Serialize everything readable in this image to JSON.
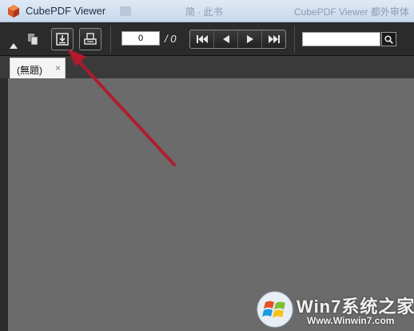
{
  "window": {
    "title": "CubePDF Viewer",
    "background_titles": [
      "简 · 此书",
      "CubePDF Viewer 都外审体"
    ]
  },
  "toolbar": {
    "page_current": "0",
    "page_total": "/ 0",
    "search_value": ""
  },
  "tabs": [
    {
      "label": "(無題)",
      "close": "×"
    }
  ],
  "watermark": {
    "brand": "Win7系统之家",
    "url": "Www.Winwin7.com"
  },
  "colors": {
    "toolbar": "#2b2b2b",
    "viewer": "#6b6b6b",
    "annotation_arrow": "#b3192a"
  }
}
